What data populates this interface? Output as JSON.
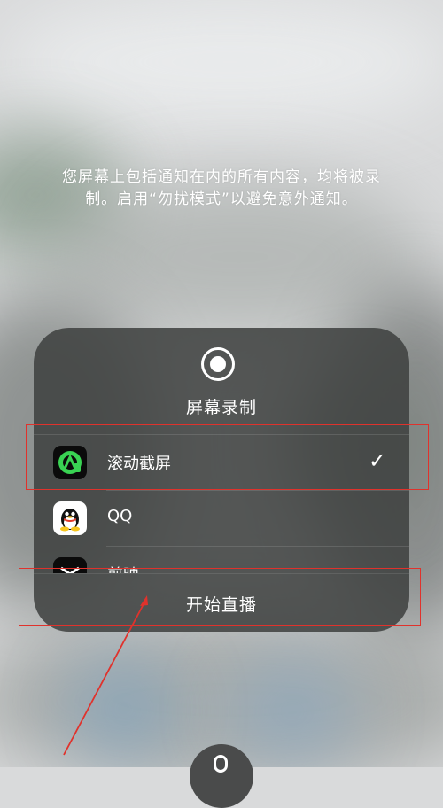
{
  "notice": {
    "line1": "您屏幕上包括通知在内的所有内容，均将被录",
    "line2": "制。启用“勿扰模式”以避免意外通知。"
  },
  "panel": {
    "title": "屏幕录制",
    "icon": "record-icon",
    "apps": [
      {
        "label": "滚动截屏",
        "icon": "scroll-screenshot-app-icon",
        "selected": true
      },
      {
        "label": "QQ",
        "icon": "qq-app-icon",
        "selected": false
      },
      {
        "label": "剪映",
        "icon": "jianying-app-icon",
        "selected": false
      }
    ],
    "check_glyph": "✓",
    "start_label": "开始直播"
  },
  "colors": {
    "highlight": "#e0322c",
    "panel_bg": "#3e403f",
    "scroll_app_green": "#39d353",
    "qq_yellow": "#f7c51d"
  }
}
